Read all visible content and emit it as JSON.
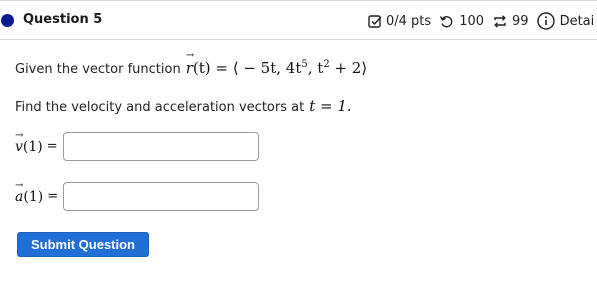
{
  "header": {
    "title": "Question 5",
    "score": "0/4 pts",
    "retries_count": "100",
    "attempts_count": "99",
    "details_label": "Detai"
  },
  "question": {
    "intro_text": "Given the vector function",
    "function_lhs_name": "r",
    "function_lhs_var": "(t) =",
    "function_rhs": "⟨ − 5t, 4t",
    "exp5": "5",
    "rhs_mid": ", t",
    "exp2": "2",
    "rhs_end": " + 2⟩",
    "find_text": "Find the velocity and acceleration vectors at",
    "find_math": "t = 1.",
    "velocity_label_name": "v",
    "velocity_label_arg": "(1)",
    "acceleration_label_name": "a",
    "acceleration_label_arg": "(1)",
    "equals": "=",
    "velocity_value": "",
    "acceleration_value": ""
  },
  "actions": {
    "submit_label": "Submit Question"
  }
}
